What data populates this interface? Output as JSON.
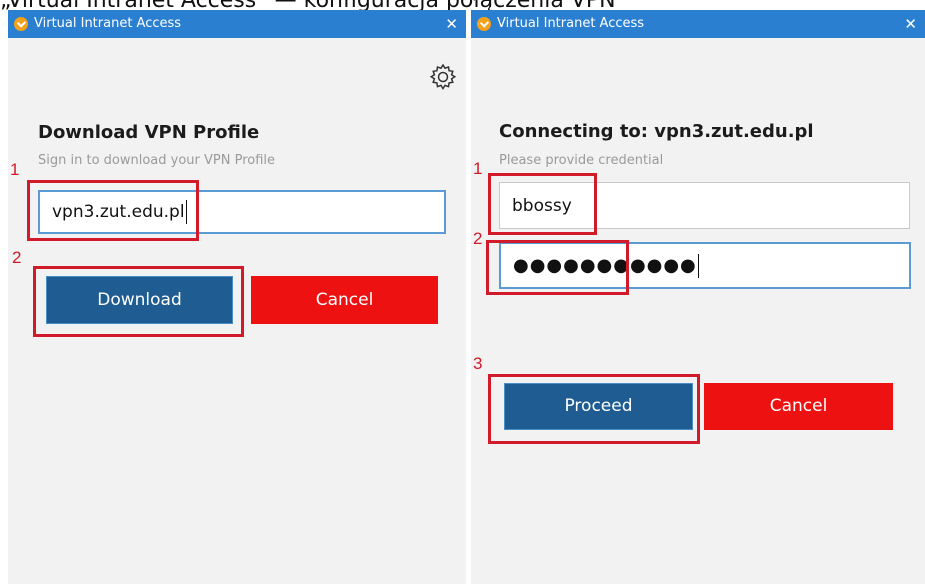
{
  "top_text": "„Virtual Intranet Access” — konfiguracja połączenia VPN",
  "left_window": {
    "title": "Virtual Intranet Access",
    "heading": "Download VPN Profile",
    "subtext": "Sign in to download your VPN Profile",
    "server_value": "vpn3.zut.edu.pl",
    "download_label": "Download",
    "cancel_label": "Cancel",
    "step1": "1",
    "step2": "2"
  },
  "right_window": {
    "title": "Virtual Intranet Access",
    "heading": "Connecting to: vpn3.zut.edu.pl",
    "subtext": "Please provide credential",
    "username_value": "bbossy",
    "password_mask": "●●●●●●●●●●●",
    "proceed_label": "Proceed",
    "cancel_label": "Cancel",
    "step1": "1",
    "step2": "2",
    "step3": "3"
  },
  "colors": {
    "titlebar": "#2b7fd0",
    "primary_button": "#1f5c91",
    "cancel_button": "#ee1111",
    "annotation": "#d11a2a"
  }
}
